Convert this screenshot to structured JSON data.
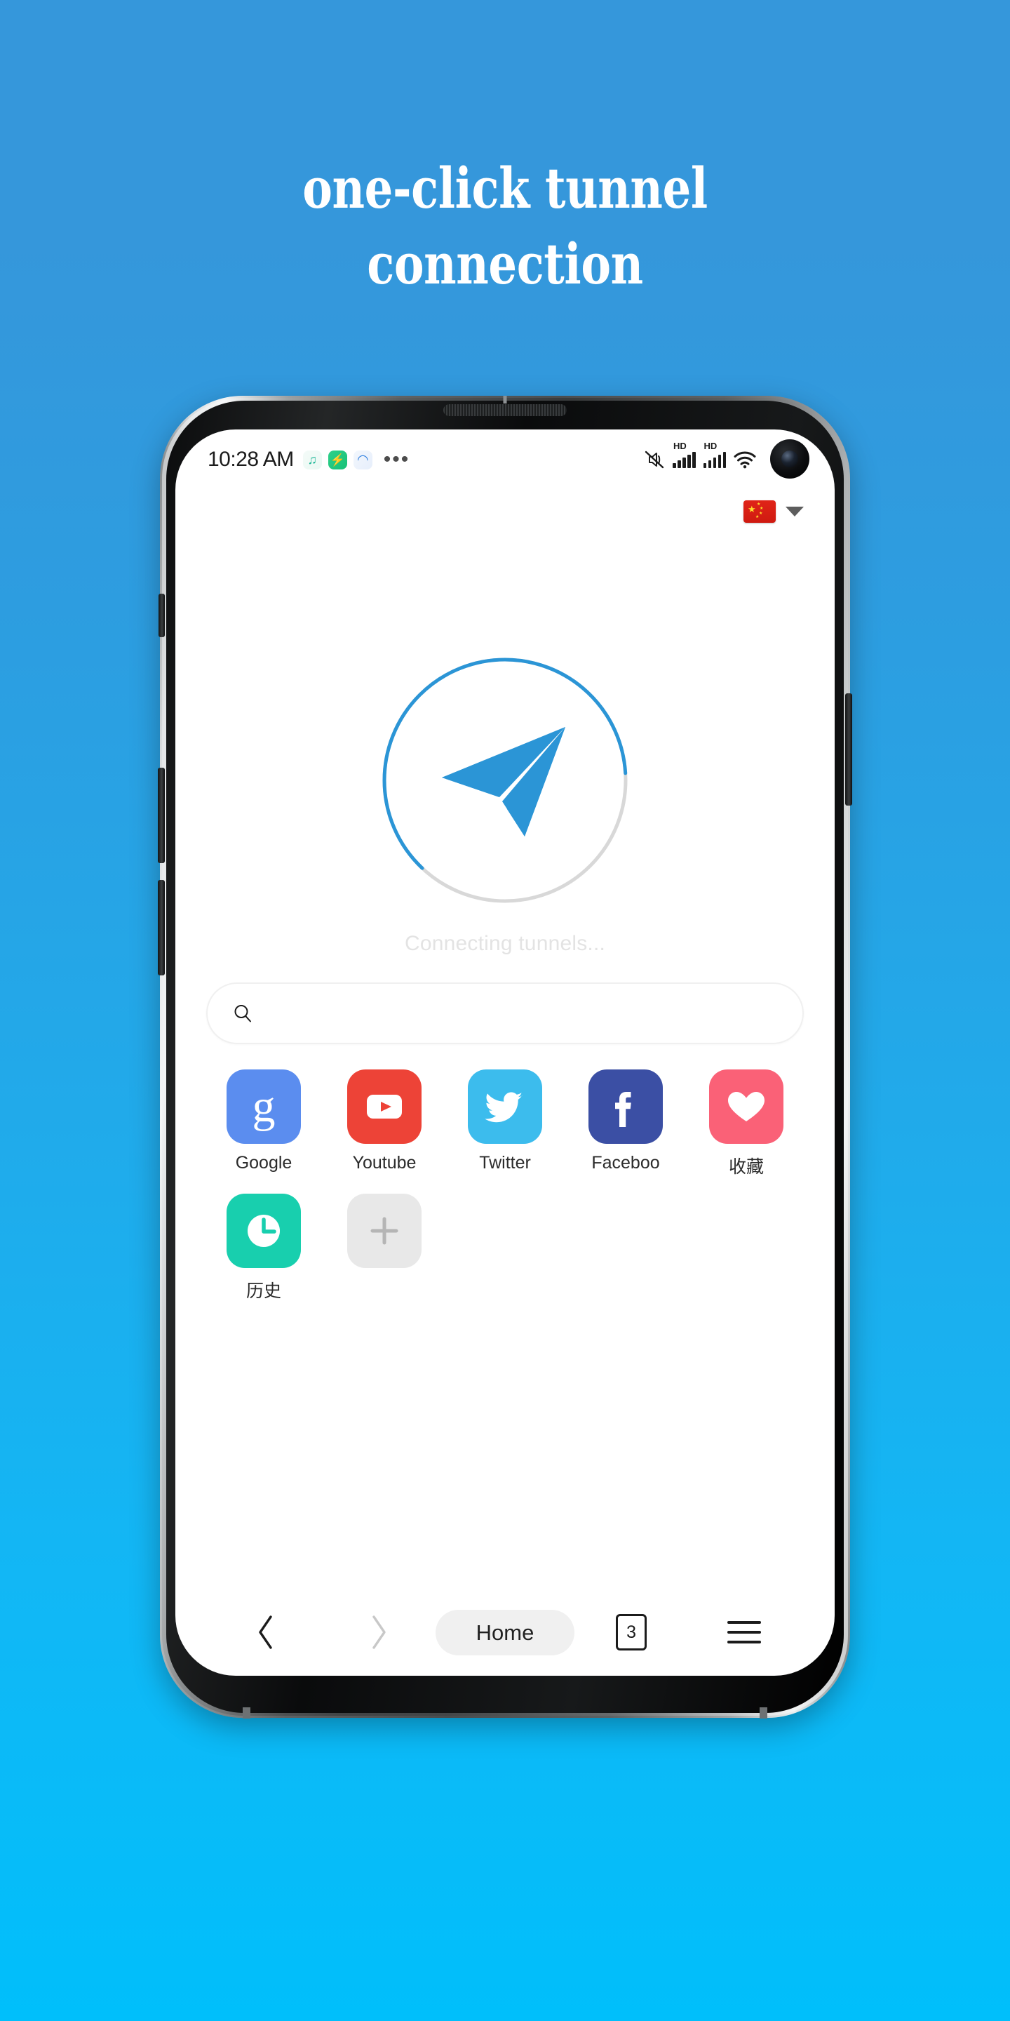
{
  "promo": {
    "headline_line_1": "one-click tunnel",
    "headline_line_2": "connection",
    "background_top_color": "#3597db",
    "background_bottom_color": "#00bffb"
  },
  "status_bar": {
    "time": "10:28 AM",
    "app_icon_1": "♫",
    "app_icon_2": "⚡",
    "app_icon_3": "◠",
    "overflow": "•••",
    "hd_label_1": "HD",
    "hd_label_2": "HD",
    "icons": [
      "mute-icon",
      "signal-icon",
      "signal-icon",
      "wifi-icon",
      "camera-punch-hole"
    ]
  },
  "region_selector": {
    "flag": "🇨🇳",
    "caret": "▾"
  },
  "connection": {
    "status_text": "Connecting tunnels...",
    "logo_icon": "paper-plane-icon",
    "accent_color": "#2b95d6",
    "track_color": "#d8d8d8",
    "progress_percent": 62
  },
  "search": {
    "value": "",
    "placeholder": "",
    "icon": "search-icon"
  },
  "shortcuts": [
    {
      "label": "Google",
      "icon": "google-icon",
      "color": "#5b8def"
    },
    {
      "label": "Youtube",
      "icon": "youtube-icon",
      "color": "#ed4337"
    },
    {
      "label": "Twitter",
      "icon": "twitter-icon",
      "color": "#3cbced"
    },
    {
      "label": "Faceboo",
      "icon": "facebook-icon",
      "color": "#3b4fa4"
    },
    {
      "label": "收藏",
      "icon": "heart-icon",
      "color": "#fa6177"
    },
    {
      "label": "历史",
      "icon": "clock-icon",
      "color": "#18cfae"
    },
    {
      "label": "",
      "icon": "plus-icon",
      "color": "#e8e8e8"
    }
  ],
  "bottom_nav": {
    "back_label": "back-icon",
    "forward_label": "forward-icon",
    "home_label": "Home",
    "tab_count": "3",
    "menu_label": "menu-icon"
  }
}
